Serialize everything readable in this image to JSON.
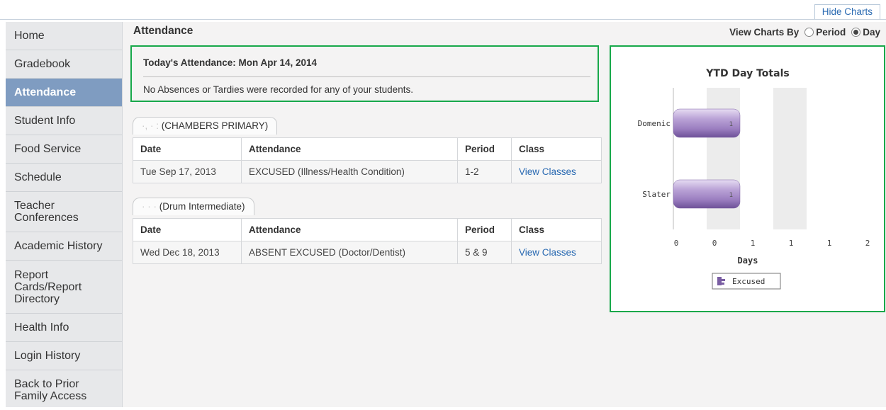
{
  "topbar": {
    "hide_charts_label": "Hide Charts"
  },
  "sidebar": {
    "items": [
      {
        "label": "Home",
        "active": false
      },
      {
        "label": "Gradebook",
        "active": false
      },
      {
        "label": "Attendance",
        "active": true
      },
      {
        "label": "Student Info",
        "active": false
      },
      {
        "label": "Food Service",
        "active": false
      },
      {
        "label": "Schedule",
        "active": false
      },
      {
        "label": "Teacher Conferences",
        "active": false
      },
      {
        "label": "Academic History",
        "active": false
      },
      {
        "label": "Report Cards/Report Directory",
        "active": false
      },
      {
        "label": "Health Info",
        "active": false
      },
      {
        "label": "Login History",
        "active": false
      },
      {
        "label": "Back to Prior Family Access",
        "active": false
      }
    ]
  },
  "main": {
    "title": "Attendance",
    "view_by": {
      "label": "View Charts By",
      "options": [
        "Period",
        "Day"
      ],
      "selected": "Day"
    },
    "today": {
      "title": "Today's Attendance: Mon Apr 14, 2014",
      "message": "No Absences or Tardies were recorded for any of your students."
    },
    "students": [
      {
        "tab_name_redacted": "·,  ·  :",
        "tab_school": "(CHAMBERS PRIMARY)",
        "headers": [
          "Date",
          "Attendance",
          "Period",
          "Class"
        ],
        "rows": [
          {
            "date": "Tue Sep 17, 2013",
            "attendance": "EXCUSED (Illness/Health Condition)",
            "period": "1-2",
            "class_link": "View Classes"
          }
        ]
      },
      {
        "tab_name_redacted": "· · ·",
        "tab_school": "(Drum Intermediate)",
        "headers": [
          "Date",
          "Attendance",
          "Period",
          "Class"
        ],
        "rows": [
          {
            "date": "Wed Dec 18, 2013",
            "attendance": "ABSENT EXCUSED (Doctor/Dentist)",
            "period": "5 & 9",
            "class_link": "View Classes"
          }
        ]
      }
    ]
  },
  "chart_data": {
    "type": "bar",
    "orientation": "horizontal",
    "title": "YTD Day Totals",
    "categories": [
      "Domenic",
      "Slater"
    ],
    "series": [
      {
        "name": "Excused",
        "values": [
          1,
          1
        ]
      }
    ],
    "data_labels": [
      "1",
      "1"
    ],
    "xlabel": "Days",
    "ylabel": "",
    "xlim": [
      0,
      2
    ],
    "x_tick_labels": [
      "0",
      "0",
      "1",
      "1",
      "1",
      "2"
    ],
    "bar_color": "#9b7ec0",
    "legend_position": "bottom-center",
    "grid": "alternating-bands"
  },
  "colors": {
    "accent_green": "#17a84a",
    "nav_active": "#7f9cc1",
    "link": "#2a6ab2"
  }
}
